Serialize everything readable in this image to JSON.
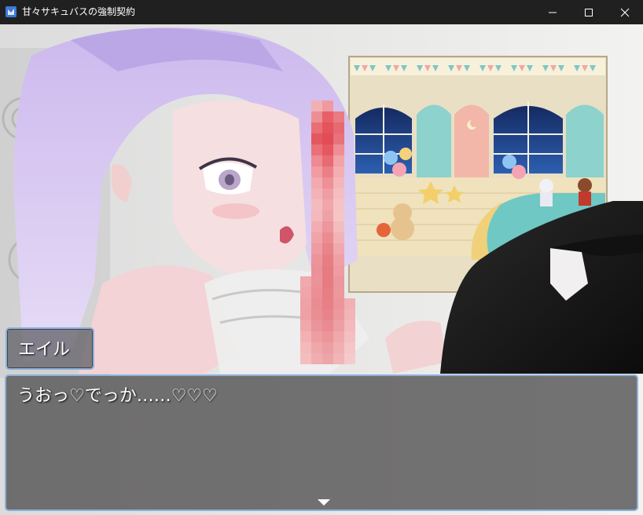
{
  "window": {
    "title": "甘々サキュバスの強制契約"
  },
  "dialogue": {
    "speaker": "エイル",
    "message": "うおっ♡でっか……♡♡♡"
  },
  "icons": {
    "app": "rpg-maker-app-icon",
    "minimize": "minimize-icon",
    "maximize": "maximize-icon",
    "close": "close-icon",
    "advance": "advance-cursor-icon"
  },
  "colors": {
    "titlebar": "#202020",
    "window_border": "#8fb0d8",
    "hair": "#d8c8f0",
    "skin": "#f6dfe0",
    "room_wall": "#eae0c8",
    "night_window": "#1e3a78"
  }
}
